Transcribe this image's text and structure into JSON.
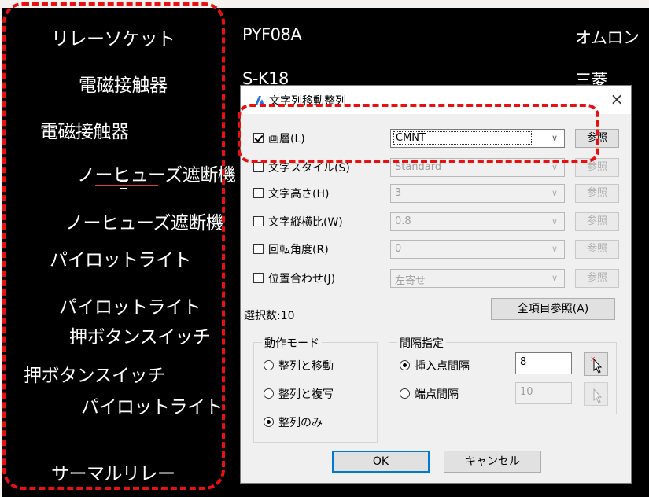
{
  "cad": {
    "left_texts": [
      "リレーソケット",
      "電磁接触器",
      "電磁接触器",
      "ノーヒューズ遮断機",
      "ノーヒューズ遮断機",
      "パイロットライト",
      "パイロットライト",
      "押ボタンスイッチ",
      "押ボタンスイッチ",
      "パイロットライト",
      "サーマルリレー"
    ],
    "model_1": "PYF08A",
    "maker_1": "オムロン",
    "model_2": "S-K18",
    "maker_2": "三菱"
  },
  "dialog": {
    "title": "文字列移動整列",
    "close_glyph": "×",
    "rows": [
      {
        "label": "画層(L)",
        "checked": true,
        "value": "CMNT",
        "enabled": true,
        "ref": "参照"
      },
      {
        "label": "文字スタイル(S)",
        "checked": false,
        "value": "Standard",
        "enabled": false,
        "ref": "参照"
      },
      {
        "label": "文字高さ(H)",
        "checked": false,
        "value": "3",
        "enabled": false,
        "ref": "参照"
      },
      {
        "label": "文字縦横比(W)",
        "checked": false,
        "value": "0.8",
        "enabled": false,
        "ref": "参照"
      },
      {
        "label": "回転角度(R)",
        "checked": false,
        "value": "0",
        "enabled": false,
        "ref": "参照"
      },
      {
        "label": "位置合わせ(J)",
        "checked": false,
        "value": "左寄せ",
        "enabled": false,
        "ref": "参照"
      }
    ],
    "selection_count": "選択数:10",
    "all_ref_button": "全項目参照(A)",
    "mode_group": {
      "title": "動作モード",
      "options": [
        "整列と移動",
        "整列と複写",
        "整列のみ"
      ],
      "selected_index": 2
    },
    "spacing_group": {
      "title": "間隔指定",
      "insert_label": "挿入点間隔",
      "insert_value": "8",
      "end_label": "端点間隔",
      "end_value": "10",
      "selected": "insert"
    },
    "ok_label": "OK",
    "cancel_label": "キャンセル"
  },
  "colors": {
    "annotation": "#e81010",
    "cad_background": "#000000",
    "dialog_bg": "#f0f0f0",
    "accent": "#0078d7"
  }
}
